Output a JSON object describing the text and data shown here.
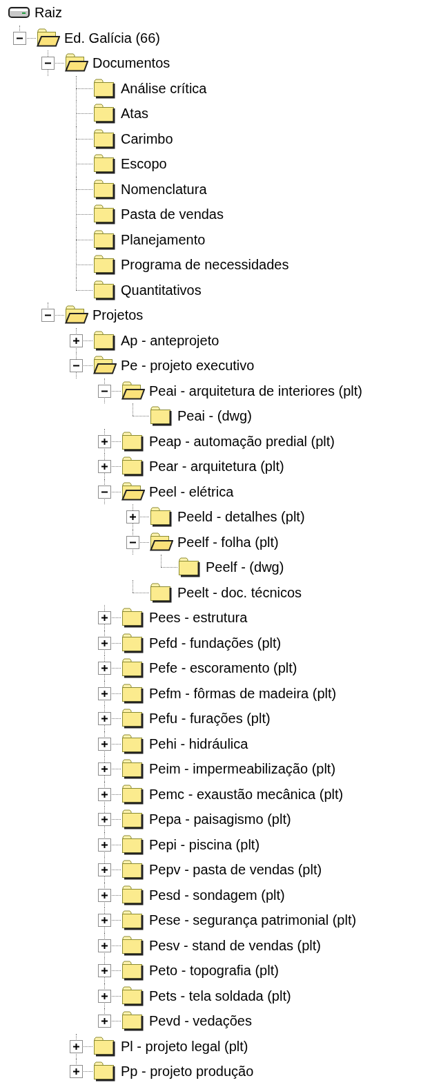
{
  "tree": {
    "label": "Raiz",
    "kind": "drive",
    "children": [
      {
        "label": "Ed. Galícia (66)",
        "kind": "folder",
        "expanded": true,
        "children": [
          {
            "label": "Documentos",
            "kind": "folder",
            "expanded": true,
            "children": [
              {
                "label": "Análise crítica",
                "kind": "folder"
              },
              {
                "label": "Atas",
                "kind": "folder"
              },
              {
                "label": "Carimbo",
                "kind": "folder"
              },
              {
                "label": "Escopo",
                "kind": "folder"
              },
              {
                "label": "Nomenclatura",
                "kind": "folder"
              },
              {
                "label": "Pasta de vendas",
                "kind": "folder"
              },
              {
                "label": "Planejamento",
                "kind": "folder"
              },
              {
                "label": "Programa de necessidades",
                "kind": "folder"
              },
              {
                "label": "Quantitativos",
                "kind": "folder"
              }
            ]
          },
          {
            "label": "Projetos",
            "kind": "folder",
            "expanded": true,
            "children": [
              {
                "label": "Ap - anteprojeto",
                "kind": "folder",
                "expanded": false
              },
              {
                "label": "Pe - projeto executivo",
                "kind": "folder",
                "expanded": true,
                "children": [
                  {
                    "label": "Peai - arquitetura de interiores (plt)",
                    "kind": "folder",
                    "expanded": true,
                    "children": [
                      {
                        "label": "Peai - (dwg)",
                        "kind": "folder"
                      }
                    ]
                  },
                  {
                    "label": "Peap - automação predial (plt)",
                    "kind": "folder",
                    "expanded": false
                  },
                  {
                    "label": "Pear - arquitetura (plt)",
                    "kind": "folder",
                    "expanded": false
                  },
                  {
                    "label": "Peel - elétrica",
                    "kind": "folder",
                    "expanded": true,
                    "children": [
                      {
                        "label": "Peeld - detalhes (plt)",
                        "kind": "folder",
                        "expanded": false
                      },
                      {
                        "label": "Peelf - folha (plt)",
                        "kind": "folder",
                        "expanded": true,
                        "children": [
                          {
                            "label": "Peelf - (dwg)",
                            "kind": "folder"
                          }
                        ]
                      },
                      {
                        "label": "Peelt - doc. técnicos",
                        "kind": "folder"
                      }
                    ]
                  },
                  {
                    "label": "Pees - estrutura",
                    "kind": "folder",
                    "expanded": false
                  },
                  {
                    "label": "Pefd - fundações (plt)",
                    "kind": "folder",
                    "expanded": false
                  },
                  {
                    "label": "Pefe - escoramento (plt)",
                    "kind": "folder",
                    "expanded": false
                  },
                  {
                    "label": "Pefm - fôrmas de madeira (plt)",
                    "kind": "folder",
                    "expanded": false
                  },
                  {
                    "label": "Pefu - furações (plt)",
                    "kind": "folder",
                    "expanded": false
                  },
                  {
                    "label": "Pehi - hidráulica",
                    "kind": "folder",
                    "expanded": false
                  },
                  {
                    "label": "Peim - impermeabilização (plt)",
                    "kind": "folder",
                    "expanded": false
                  },
                  {
                    "label": "Pemc - exaustão mecânica (plt)",
                    "kind": "folder",
                    "expanded": false
                  },
                  {
                    "label": "Pepa - paisagismo (plt)",
                    "kind": "folder",
                    "expanded": false
                  },
                  {
                    "label": "Pepi - piscina (plt)",
                    "kind": "folder",
                    "expanded": false
                  },
                  {
                    "label": "Pepv - pasta de vendas (plt)",
                    "kind": "folder",
                    "expanded": false
                  },
                  {
                    "label": "Pesd - sondagem (plt)",
                    "kind": "folder",
                    "expanded": false
                  },
                  {
                    "label": "Pese - segurança patrimonial (plt)",
                    "kind": "folder",
                    "expanded": false
                  },
                  {
                    "label": "Pesv - stand de vendas (plt)",
                    "kind": "folder",
                    "expanded": false
                  },
                  {
                    "label": "Peto - topografia (plt)",
                    "kind": "folder",
                    "expanded": false
                  },
                  {
                    "label": "Pets - tela soldada (plt)",
                    "kind": "folder",
                    "expanded": false
                  },
                  {
                    "label": "Pevd - vedações",
                    "kind": "folder",
                    "expanded": false
                  }
                ]
              },
              {
                "label": "Pl - projeto legal (plt)",
                "kind": "folder",
                "expanded": false
              },
              {
                "label": "Pp - projeto produção",
                "kind": "folder",
                "expanded": false
              }
            ]
          }
        ]
      }
    ]
  }
}
